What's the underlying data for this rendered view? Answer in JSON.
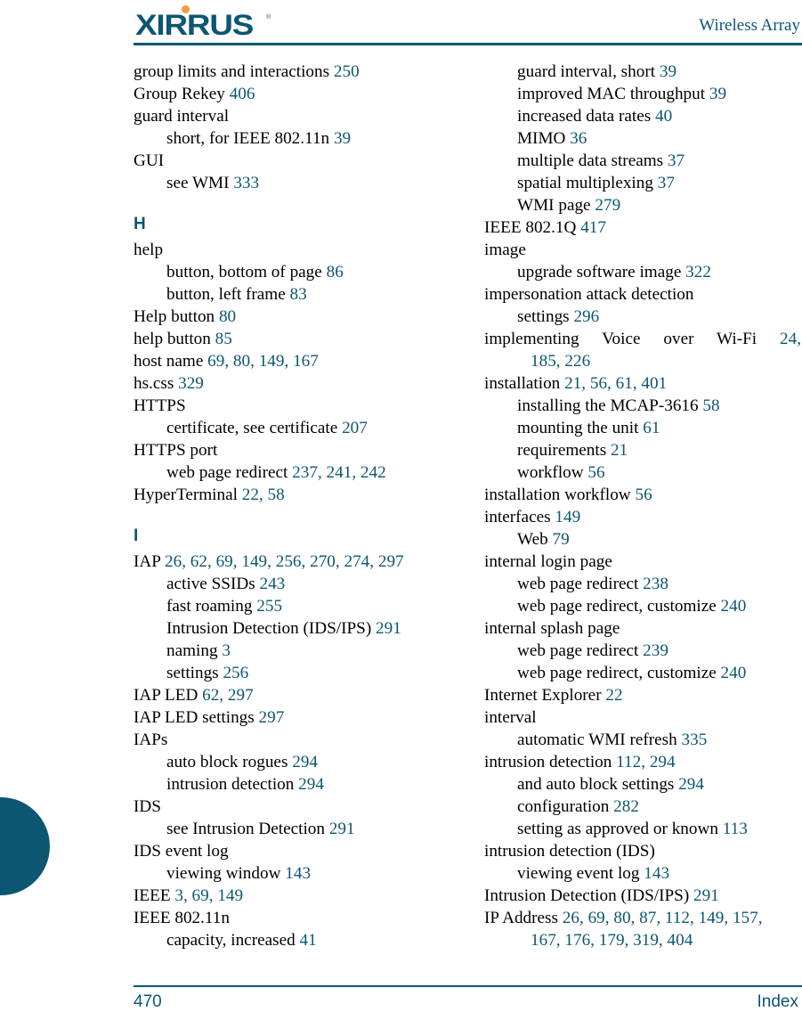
{
  "header": {
    "logo_text": "XIRRUS",
    "logo_reg": "®",
    "title": "Wireless Array",
    "colors": {
      "brand": "#0d5672",
      "logo_dot": "#f39a3b"
    }
  },
  "footer": {
    "page_number": "470",
    "section": "Index"
  },
  "left_column": [
    {
      "type": "entry",
      "level": 0,
      "term": "group limits and interactions ",
      "pages": "250"
    },
    {
      "type": "entry",
      "level": 0,
      "term": "Group Rekey ",
      "pages": "406"
    },
    {
      "type": "entry",
      "level": 0,
      "term": "guard interval",
      "pages": ""
    },
    {
      "type": "entry",
      "level": 1,
      "term": "short, for IEEE 802.11n ",
      "pages": "39"
    },
    {
      "type": "entry",
      "level": 0,
      "term": "GUI",
      "pages": ""
    },
    {
      "type": "entry",
      "level": 1,
      "term": "see WMI ",
      "pages": "333"
    },
    {
      "type": "letter",
      "label": "H"
    },
    {
      "type": "entry",
      "level": 0,
      "term": "help",
      "pages": ""
    },
    {
      "type": "entry",
      "level": 1,
      "term": "button, bottom of page ",
      "pages": "86"
    },
    {
      "type": "entry",
      "level": 1,
      "term": "button, left frame ",
      "pages": "83"
    },
    {
      "type": "entry",
      "level": 0,
      "term": "Help button ",
      "pages": "80"
    },
    {
      "type": "entry",
      "level": 0,
      "term": "help button ",
      "pages": "85"
    },
    {
      "type": "entry",
      "level": 0,
      "term": "host name ",
      "pages": "69, 80, 149, 167"
    },
    {
      "type": "entry",
      "level": 0,
      "term": "hs.css ",
      "pages": "329"
    },
    {
      "type": "entry",
      "level": 0,
      "term": "HTTPS",
      "pages": ""
    },
    {
      "type": "entry",
      "level": 1,
      "term": "certificate, see certificate ",
      "pages": "207"
    },
    {
      "type": "entry",
      "level": 0,
      "term": "HTTPS port",
      "pages": ""
    },
    {
      "type": "entry",
      "level": 1,
      "term": "web page redirect ",
      "pages": "237, 241, 242"
    },
    {
      "type": "entry",
      "level": 0,
      "term": "HyperTerminal ",
      "pages": "22, 58"
    },
    {
      "type": "letter",
      "label": "I"
    },
    {
      "type": "entry",
      "level": 0,
      "term": "IAP ",
      "pages": "26, 62, 69, 149, 256, 270, 274, 297"
    },
    {
      "type": "entry",
      "level": 1,
      "term": "active SSIDs ",
      "pages": "243"
    },
    {
      "type": "entry",
      "level": 1,
      "term": "fast roaming ",
      "pages": "255"
    },
    {
      "type": "entry",
      "level": 1,
      "term": "Intrusion Detection (IDS/IPS) ",
      "pages": "291"
    },
    {
      "type": "entry",
      "level": 1,
      "term": "naming ",
      "pages": "3"
    },
    {
      "type": "entry",
      "level": 1,
      "term": "settings ",
      "pages": "256"
    },
    {
      "type": "entry",
      "level": 0,
      "term": "IAP LED ",
      "pages": "62, 297"
    },
    {
      "type": "entry",
      "level": 0,
      "term": "IAP LED settings ",
      "pages": "297"
    },
    {
      "type": "entry",
      "level": 0,
      "term": "IAPs",
      "pages": ""
    },
    {
      "type": "entry",
      "level": 1,
      "term": "auto block rogues ",
      "pages": "294"
    },
    {
      "type": "entry",
      "level": 1,
      "term": "intrusion detection ",
      "pages": "294"
    },
    {
      "type": "entry",
      "level": 0,
      "term": "IDS",
      "pages": ""
    },
    {
      "type": "entry",
      "level": 1,
      "term": "see Intrusion Detection ",
      "pages": "291"
    },
    {
      "type": "entry",
      "level": 0,
      "term": "IDS event log",
      "pages": ""
    },
    {
      "type": "entry",
      "level": 1,
      "term": "viewing window ",
      "pages": "143"
    },
    {
      "type": "entry",
      "level": 0,
      "term": "IEEE ",
      "pages": "3, 69, 149"
    },
    {
      "type": "entry",
      "level": 0,
      "term": "IEEE 802.11n",
      "pages": ""
    },
    {
      "type": "entry",
      "level": 1,
      "term": "capacity, increased ",
      "pages": "41"
    }
  ],
  "right_column": [
    {
      "type": "entry",
      "level": 1,
      "term": "guard interval, short ",
      "pages": "39"
    },
    {
      "type": "entry",
      "level": 1,
      "term": "improved MAC throughput ",
      "pages": "39"
    },
    {
      "type": "entry",
      "level": 1,
      "term": "increased data rates ",
      "pages": "40"
    },
    {
      "type": "entry",
      "level": 1,
      "term": "MIMO ",
      "pages": "36"
    },
    {
      "type": "entry",
      "level": 1,
      "term": "multiple data streams ",
      "pages": "37"
    },
    {
      "type": "entry",
      "level": 1,
      "term": "spatial multiplexing ",
      "pages": "37"
    },
    {
      "type": "entry",
      "level": 1,
      "term": "WMI page ",
      "pages": "279"
    },
    {
      "type": "entry",
      "level": 0,
      "term": "IEEE 802.1Q ",
      "pages": "417"
    },
    {
      "type": "entry",
      "level": 0,
      "term": "image",
      "pages": ""
    },
    {
      "type": "entry",
      "level": 1,
      "term": "upgrade software image ",
      "pages": "322"
    },
    {
      "type": "entry",
      "level": 0,
      "term": "impersonation attack detection",
      "pages": ""
    },
    {
      "type": "entry",
      "level": 1,
      "term": "settings ",
      "pages": "296"
    },
    {
      "type": "entry",
      "level": 0,
      "wrap": true,
      "term": "implementing Voice over Wi-Fi ",
      "pages": "24,"
    },
    {
      "type": "entry",
      "level": 2,
      "term": "",
      "pages": "185, 226"
    },
    {
      "type": "entry",
      "level": 0,
      "term": "installation ",
      "pages": "21, 56, 61, 401"
    },
    {
      "type": "entry",
      "level": 1,
      "term": "installing the MCAP-3616 ",
      "pages": "58"
    },
    {
      "type": "entry",
      "level": 1,
      "term": "mounting the unit ",
      "pages": "61"
    },
    {
      "type": "entry",
      "level": 1,
      "term": "requirements ",
      "pages": "21"
    },
    {
      "type": "entry",
      "level": 1,
      "term": "workflow ",
      "pages": "56"
    },
    {
      "type": "entry",
      "level": 0,
      "term": "installation workflow ",
      "pages": "56"
    },
    {
      "type": "entry",
      "level": 0,
      "term": "interfaces ",
      "pages": "149"
    },
    {
      "type": "entry",
      "level": 1,
      "term": "Web ",
      "pages": "79"
    },
    {
      "type": "entry",
      "level": 0,
      "term": "internal login page",
      "pages": ""
    },
    {
      "type": "entry",
      "level": 1,
      "term": "web page redirect ",
      "pages": "238"
    },
    {
      "type": "entry",
      "level": 1,
      "term": "web page redirect, customize ",
      "pages": "240"
    },
    {
      "type": "entry",
      "level": 0,
      "term": "internal splash page",
      "pages": ""
    },
    {
      "type": "entry",
      "level": 1,
      "term": "web page redirect ",
      "pages": "239"
    },
    {
      "type": "entry",
      "level": 1,
      "term": "web page redirect, customize ",
      "pages": "240"
    },
    {
      "type": "entry",
      "level": 0,
      "term": "Internet Explorer ",
      "pages": "22"
    },
    {
      "type": "entry",
      "level": 0,
      "term": "interval",
      "pages": ""
    },
    {
      "type": "entry",
      "level": 1,
      "term": "automatic WMI refresh ",
      "pages": "335"
    },
    {
      "type": "entry",
      "level": 0,
      "term": "intrusion detection ",
      "pages": "112, 294"
    },
    {
      "type": "entry",
      "level": 1,
      "term": "and auto block settings ",
      "pages": "294"
    },
    {
      "type": "entry",
      "level": 1,
      "term": "configuration ",
      "pages": "282"
    },
    {
      "type": "entry",
      "level": 1,
      "term": "setting as approved or known ",
      "pages": "113"
    },
    {
      "type": "entry",
      "level": 0,
      "term": "intrusion detection (IDS)",
      "pages": ""
    },
    {
      "type": "entry",
      "level": 1,
      "term": "viewing event log ",
      "pages": "143"
    },
    {
      "type": "entry",
      "level": 0,
      "term": "Intrusion Detection (IDS/IPS) ",
      "pages": "291"
    },
    {
      "type": "entry",
      "level": 0,
      "term": "IP Address ",
      "pages": "26, 69, 80, 87, 112, 149, 157,"
    },
    {
      "type": "entry",
      "level": 2,
      "term": "",
      "pages": "167, 176, 179, 319, 404"
    }
  ]
}
